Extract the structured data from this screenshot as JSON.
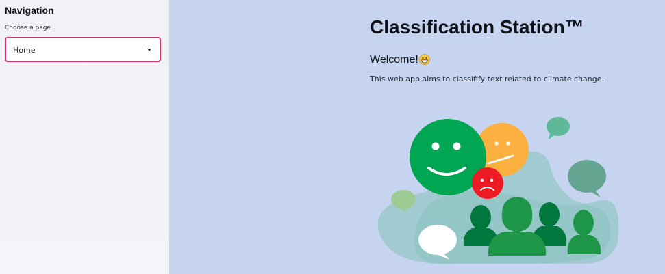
{
  "sidebar": {
    "title": "Navigation",
    "select_label": "Choose a page",
    "select_value": "Home"
  },
  "main": {
    "title": "Classification Station™",
    "welcome": "Welcome!",
    "description": "This web app aims to classifify text related to climate change.",
    "emoji_icon": "grinning-face-icon"
  },
  "colors": {
    "sidebar_bg": "#f0f2f6",
    "main_bg": "#c7d4ef",
    "select_border": "#d6336c",
    "happy_face": "#00a651",
    "neutral_face": "#fbb040",
    "sad_face": "#ed1c24"
  }
}
